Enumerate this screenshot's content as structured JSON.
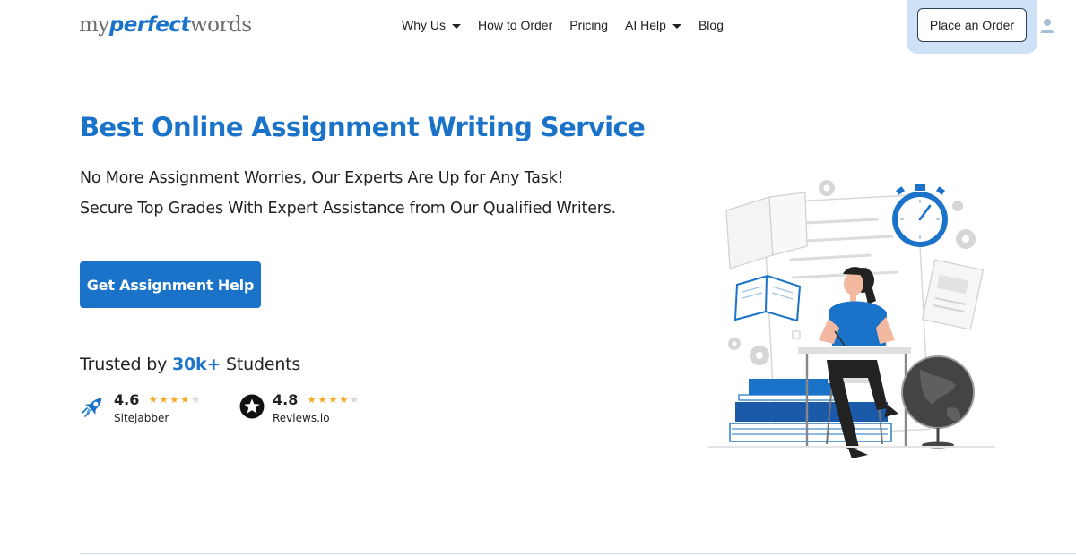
{
  "logo": {
    "part1": "my",
    "part2": "perfect",
    "part3": "words"
  },
  "nav": {
    "items": [
      {
        "label": "Why Us",
        "has_dropdown": true
      },
      {
        "label": "How to Order",
        "has_dropdown": false
      },
      {
        "label": "Pricing",
        "has_dropdown": false
      },
      {
        "label": "AI Help",
        "has_dropdown": true
      },
      {
        "label": "Blog",
        "has_dropdown": false
      }
    ],
    "order_button": "Place an Order",
    "user_icon": "user-icon"
  },
  "hero": {
    "title": "Best Online Assignment Writing Service",
    "line1": "No More Assignment Worries, Our Experts Are Up for Any Task!",
    "line2": "Secure Top Grades With Expert Assistance from Our Qualified Writers.",
    "cta": "Get Assignment Help",
    "trusted_prefix": "Trusted by",
    "trusted_highlight": "30k+",
    "trusted_suffix": "Students"
  },
  "ratings": [
    {
      "score": "4.6",
      "source": "Sitejabber",
      "stars_filled": 4,
      "stars_total": 5,
      "icon": "rocket-icon"
    },
    {
      "score": "4.8",
      "source": "Reviews.io",
      "stars_filled": 4,
      "stars_total": 5,
      "icon": "star-badge-icon"
    }
  ],
  "colors": {
    "accent": "#1a73c8",
    "star": "#f5a623",
    "order_highlight": "#cfe1f6"
  }
}
